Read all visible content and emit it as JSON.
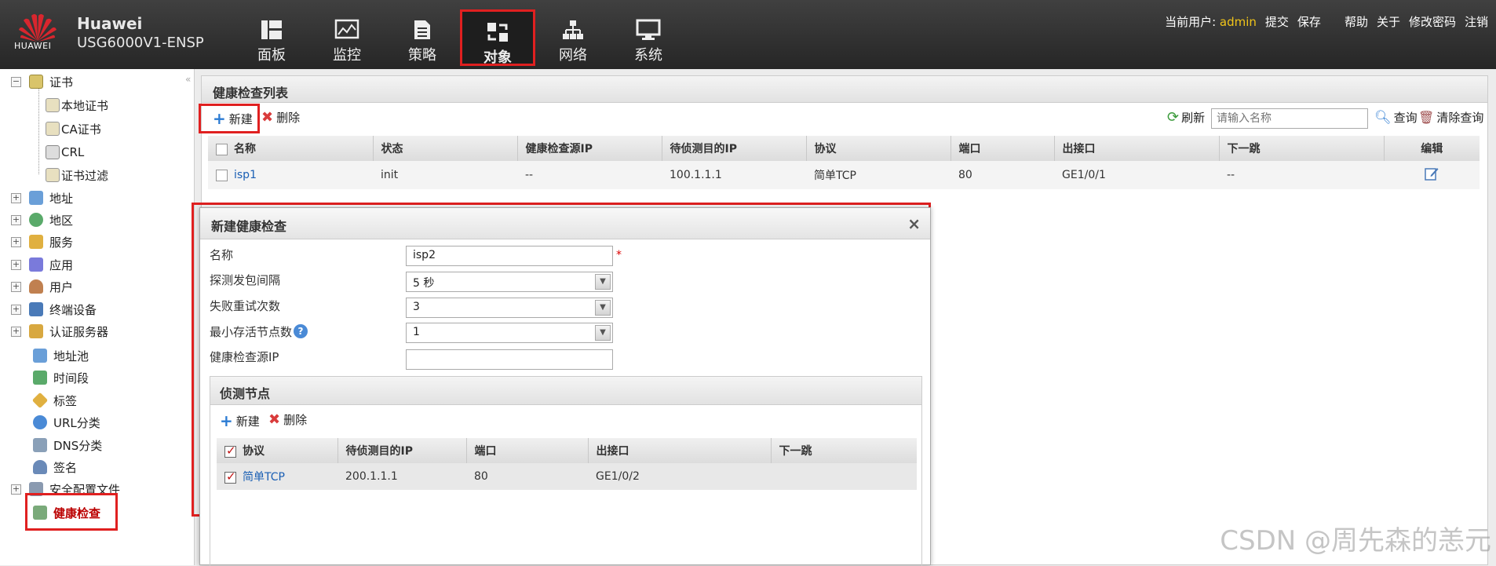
{
  "header": {
    "brand": "Huawei",
    "model": "USG6000V1-ENSP",
    "logo_text": "HUAWEI",
    "nav": [
      {
        "label": "面板",
        "icon": "dashboard-icon"
      },
      {
        "label": "监控",
        "icon": "monitor-icon"
      },
      {
        "label": "策略",
        "icon": "policy-icon"
      },
      {
        "label": "对象",
        "icon": "object-icon",
        "active": true
      },
      {
        "label": "网络",
        "icon": "network-icon"
      },
      {
        "label": "系统",
        "icon": "system-icon"
      }
    ],
    "current_user_label": "当前用户:",
    "user": "admin",
    "links": [
      "提交",
      "保存",
      "帮助",
      "关于",
      "修改密码",
      "注销"
    ]
  },
  "sidebar": {
    "items": [
      {
        "label": "证书",
        "expander": "−",
        "icon": "certificate-icon"
      },
      {
        "label": "本地证书",
        "icon": "local-cert-icon"
      },
      {
        "label": "CA证书",
        "icon": "ca-cert-icon"
      },
      {
        "label": "CRL",
        "icon": "crl-icon"
      },
      {
        "label": "证书过滤",
        "icon": "cert-filter-icon"
      },
      {
        "label": "地址",
        "expander": "+",
        "icon": "address-icon"
      },
      {
        "label": "地区",
        "expander": "+",
        "icon": "region-icon"
      },
      {
        "label": "服务",
        "expander": "+",
        "icon": "service-icon"
      },
      {
        "label": "应用",
        "expander": "+",
        "icon": "application-icon"
      },
      {
        "label": "用户",
        "expander": "+",
        "icon": "user-icon"
      },
      {
        "label": "终端设备",
        "expander": "+",
        "icon": "terminal-icon"
      },
      {
        "label": "认证服务器",
        "expander": "+",
        "icon": "auth-server-icon"
      },
      {
        "label": "地址池",
        "icon": "address-pool-icon"
      },
      {
        "label": "时间段",
        "icon": "time-range-icon"
      },
      {
        "label": "标签",
        "icon": "tag-icon"
      },
      {
        "label": "URL分类",
        "icon": "url-category-icon"
      },
      {
        "label": "DNS分类",
        "icon": "dns-category-icon"
      },
      {
        "label": "签名",
        "icon": "signature-icon"
      },
      {
        "label": "安全配置文件",
        "expander": "+",
        "icon": "security-profile-icon"
      },
      {
        "label": "健康检查",
        "icon": "health-check-icon",
        "active": true
      }
    ]
  },
  "main": {
    "title": "健康检查列表",
    "toolbar": {
      "new": "新建",
      "delete": "删除",
      "refresh": "刷新",
      "search_placeholder": "请输入名称",
      "query": "查询",
      "clear_query": "清除查询"
    },
    "columns": [
      "名称",
      "状态",
      "健康检查源IP",
      "待侦测目的IP",
      "协议",
      "端口",
      "出接口",
      "下一跳",
      "编辑"
    ],
    "rows": [
      {
        "name": "isp1",
        "status": "init",
        "source_ip": "--",
        "dest_ip": "100.1.1.1",
        "protocol": "简单TCP",
        "port": "80",
        "interface": "GE1/0/1",
        "next_hop": "--"
      }
    ]
  },
  "dialog": {
    "title": "新建健康检查",
    "fields": {
      "name_label": "名称",
      "name_value": "isp2",
      "interval_label": "探测发包间隔",
      "interval_value": "5 秒",
      "retries_label": "失败重试次数",
      "retries_value": "3",
      "min_alive_label": "最小存活节点数",
      "min_alive_value": "1",
      "source_ip_label": "健康检查源IP",
      "source_ip_value": ""
    },
    "required_mark": "*",
    "detect": {
      "title": "侦测节点",
      "new": "新建",
      "delete": "删除",
      "columns": [
        "协议",
        "待侦测目的IP",
        "端口",
        "出接口",
        "下一跳"
      ],
      "rows": [
        {
          "protocol": "简单TCP",
          "dest_ip": "200.1.1.1",
          "port": "80",
          "interface": "GE1/0/2",
          "next_hop": ""
        }
      ]
    }
  },
  "watermark": "CSDN @周先森的恙元"
}
